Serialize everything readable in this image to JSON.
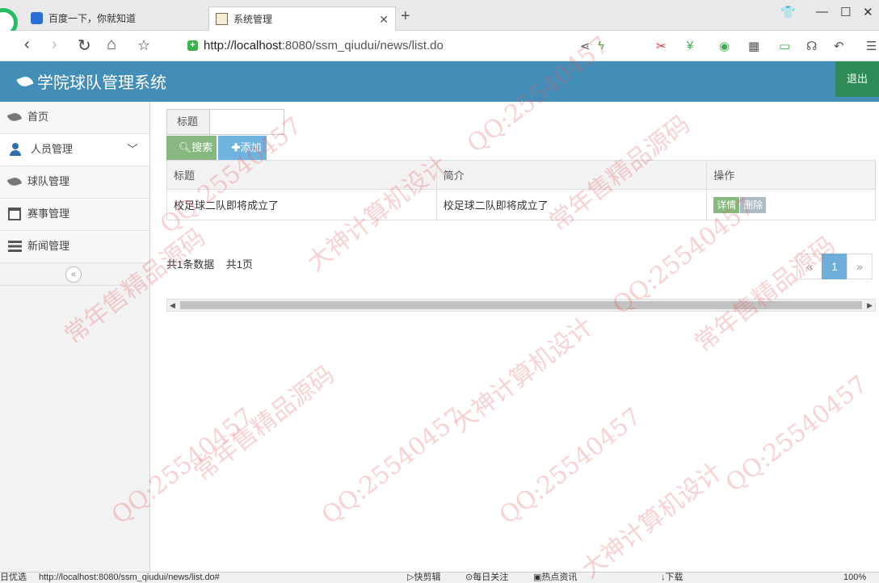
{
  "browser": {
    "tabs": [
      {
        "title": "百度一下，你就知道"
      },
      {
        "title": "系统管理"
      }
    ],
    "url_host": "http://localhost",
    "url_path": ":8080/ssm_qiudui/news/list.do",
    "status_left": "日优选",
    "status_url": "http://localhost:8080/ssm_qiudui/news/list.do#",
    "status_items": [
      "快剪辑",
      "每日关注",
      "热点资讯",
      "下载"
    ],
    "zoom": "100%"
  },
  "app": {
    "title": "学院球队管理系统",
    "logout_label": "退出"
  },
  "sidebar": {
    "items": [
      {
        "label": "首页",
        "icon": "leaf-icon"
      },
      {
        "label": "人员管理",
        "icon": "user-icon"
      },
      {
        "label": "球队管理",
        "icon": "leaf-icon"
      },
      {
        "label": "赛事管理",
        "icon": "calendar-icon"
      },
      {
        "label": "新闻管理",
        "icon": "list-icon"
      }
    ],
    "collapse_glyph": "«"
  },
  "search": {
    "label": "标题",
    "value": "",
    "search_label": "搜索",
    "add_label": "添加"
  },
  "table": {
    "columns": [
      "标题",
      "简介",
      "操作"
    ],
    "rows": [
      {
        "title": "校足球二队即将成立了",
        "intro": "校足球二队即将成立了",
        "detail": "详情",
        "delete": "删除"
      }
    ]
  },
  "pagination": {
    "total_records": "共1条数据",
    "total_pages": "共1页",
    "prev": "«",
    "current": "1",
    "next": "»"
  },
  "watermark": [
    "常年售精品源码",
    "QQ:25540457",
    "大神计算机设计"
  ]
}
